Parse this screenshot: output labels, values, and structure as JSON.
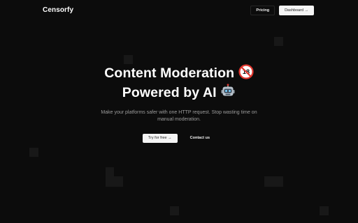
{
  "header": {
    "brand": "Censorfy",
    "nav": {
      "pricing_label": "Pricing",
      "dashboard_label": "Dashboard →"
    }
  },
  "hero": {
    "headline_line1": "Content Moderation",
    "headline_line2": "Powered by AI",
    "subtitle": "Make your platforms safer with one HTTP request. Stop wasting time on manual moderation.",
    "cta": {
      "primary_label": "Try for free →",
      "secondary_label": "Contact us"
    }
  },
  "icons": [
    "no-under-18-icon",
    "robot-icon"
  ],
  "colors": {
    "background": "#0c0c0c",
    "grid_cell": "#181818",
    "text": "#ffffff",
    "muted_text": "#9d9d9d",
    "light_button": "#f5f5f5",
    "prohibited_red": "#e0362e"
  }
}
